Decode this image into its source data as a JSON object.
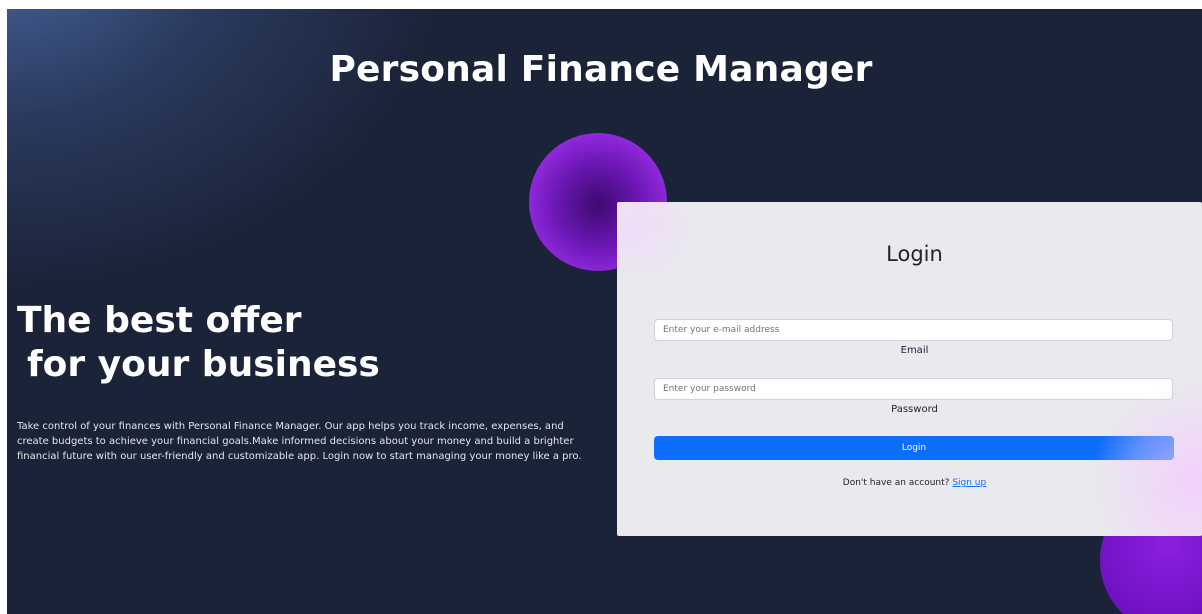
{
  "header": {
    "title": "Personal Finance Manager"
  },
  "hero": {
    "line1": "The best offer",
    "line2": "for your business",
    "description": "Take control of your finances with Personal Finance Manager. Our app helps you track income, expenses, and create budgets to achieve your financial goals.Make informed decisions about your money and build a brighter financial future with our user-friendly and customizable app. Login now to start managing your money like a pro."
  },
  "login": {
    "title": "Login",
    "email_placeholder": "Enter your e-mail address",
    "email_label": "Email",
    "password_placeholder": "Enter your password",
    "password_label": "Password",
    "button_label": "Login",
    "signup_prompt": "Don't have an account?",
    "signup_link": "Sign up"
  },
  "colors": {
    "background": "#1b2338",
    "card": "#e9e9ee",
    "primary": "#0d6efd",
    "orb": "#8c1fe0"
  }
}
